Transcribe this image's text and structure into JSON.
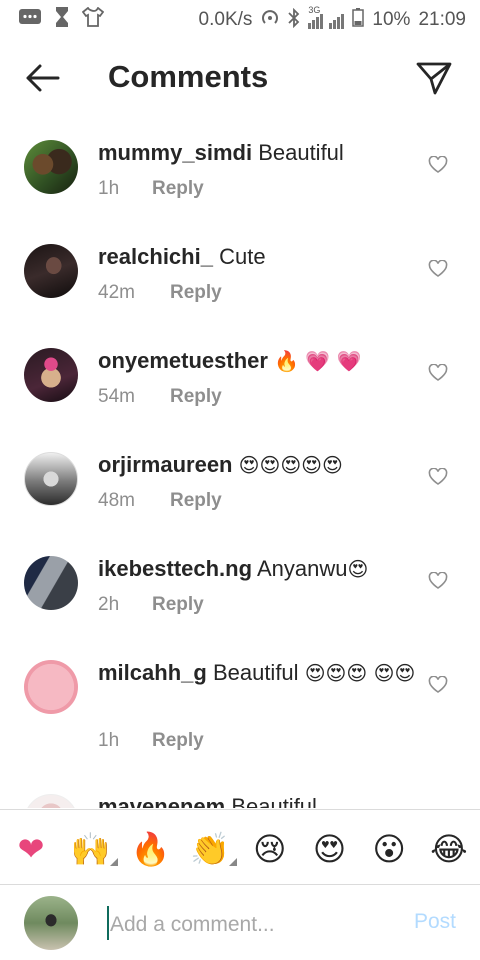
{
  "status_bar": {
    "speed": "0.0K/s",
    "network": "3G",
    "battery": "10%",
    "time": "21:09"
  },
  "header": {
    "title": "Comments"
  },
  "comments": [
    {
      "user": "mummy_simdi",
      "text": "Beautiful",
      "emojis": "",
      "time": "1h",
      "reply": "Reply"
    },
    {
      "user": "realchichi_",
      "text": "Cute",
      "emojis": "",
      "time": "42m",
      "reply": "Reply"
    },
    {
      "user": "onyemetuesther",
      "text": "",
      "emojis": "🔥 💗 💗",
      "time": "54m",
      "reply": "Reply"
    },
    {
      "user": "orjirmaureen",
      "text": "",
      "emojis": "😍😍😍😍😍",
      "time": "48m",
      "reply": "Reply"
    },
    {
      "user": "ikebesttech.ng",
      "text": "Anyanwu",
      "emojis": "😍",
      "time": "2h",
      "reply": "Reply"
    },
    {
      "user": "milcahh_g",
      "text": "Beautiful",
      "emojis": "😍😍😍 😍😍",
      "time": "1h",
      "reply": "Reply"
    },
    {
      "user": "mavenenem",
      "text": "Beautiful",
      "emojis": "",
      "time": "",
      "reply": ""
    }
  ],
  "quick_emojis": [
    "❤",
    "🙌",
    "🔥",
    "👏",
    "😢",
    "😍",
    "😮",
    "😂"
  ],
  "input": {
    "placeholder": "Add a comment...",
    "post_label": "Post"
  },
  "colors": {
    "text": "#262626",
    "muted": "#8e8e8e",
    "post_disabled": "#b3dbff",
    "heart_pink": "#e8467c",
    "divider": "#dbdbdb"
  }
}
